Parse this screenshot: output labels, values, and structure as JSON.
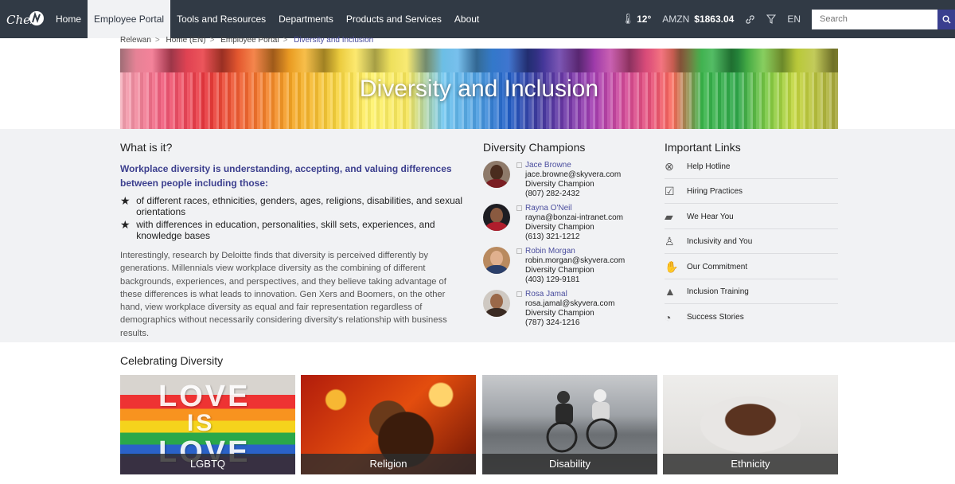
{
  "nav": {
    "logo_text": "Chez",
    "items": [
      "Home",
      "Employee Portal",
      "Tools and Resources",
      "Departments",
      "Products and Services",
      "About"
    ],
    "active_index": 1,
    "weather": "12°",
    "stock_symbol": "AMZN",
    "stock_price": "$1863.04",
    "language": "EN",
    "search_placeholder": "Search"
  },
  "breadcrumb": [
    "Relewan",
    "Home (EN)",
    "Employee Portal",
    "Diversity and Inclusion"
  ],
  "hero": {
    "title": "Diversity and Inclusion"
  },
  "what": {
    "heading": "What is it?",
    "lead": "Workplace diversity is understanding, accepting, and valuing differences between people including those:",
    "bullets": [
      "of different races, ethnicities, genders, ages, religions, disabilities, and sexual orientations",
      "with differences in education, personalities, skill sets, experiences, and knowledge bases"
    ],
    "paragraph": "Interestingly, research by Deloitte finds that diversity is perceived differently by generations. Millennials view workplace diversity as the combining of different backgrounds, experiences, and perspectives, and they believe taking advantage of these differences is what leads to innovation. Gen Xers and Boomers, on the other hand, view workplace diversity as equal and fair representation regardless of demographics without necessarily considering diversity's relationship with business results."
  },
  "champions": {
    "heading": "Diversity Champions",
    "people": [
      {
        "name": "Jace Browne",
        "email": "jace.browne@skyvera.com",
        "role": "Diversity Champion",
        "phone": "(807) 282-2432"
      },
      {
        "name": "Rayna O'Neil",
        "email": "rayna@bonzai-intranet.com",
        "role": "Diversity Champion",
        "phone": "(613) 321-1212"
      },
      {
        "name": "Robin Morgan",
        "email": "robin.morgan@skyvera.com",
        "role": "Diversity Champion",
        "phone": "(403) 129-9181"
      },
      {
        "name": "Rosa Jamal",
        "email": "rosa.jamal@skyvera.com",
        "role": "Diversity Champion",
        "phone": "(787) 324-1216"
      }
    ]
  },
  "links": {
    "heading": "Important Links",
    "items": [
      {
        "label": "Help Hotline",
        "icon": "lifebuoy-icon"
      },
      {
        "label": "Hiring Practices",
        "icon": "clipboard-check-icon"
      },
      {
        "label": "We Hear You",
        "icon": "chat-bubbles-icon"
      },
      {
        "label": "Inclusivity and You",
        "icon": "person-icon"
      },
      {
        "label": "Our Commitment",
        "icon": "handshake-icon"
      },
      {
        "label": "Inclusion Training",
        "icon": "graduation-icon"
      },
      {
        "label": "Success Stories",
        "icon": "rss-icon"
      }
    ]
  },
  "celebrating": {
    "heading": "Celebrating Diversity",
    "tiles": [
      "LGBTQ",
      "Religion",
      "Disability",
      "Ethnicity"
    ]
  },
  "tile_art": {
    "love_1": "LOVE",
    "is": "IS",
    "love_2": "LOVE"
  }
}
